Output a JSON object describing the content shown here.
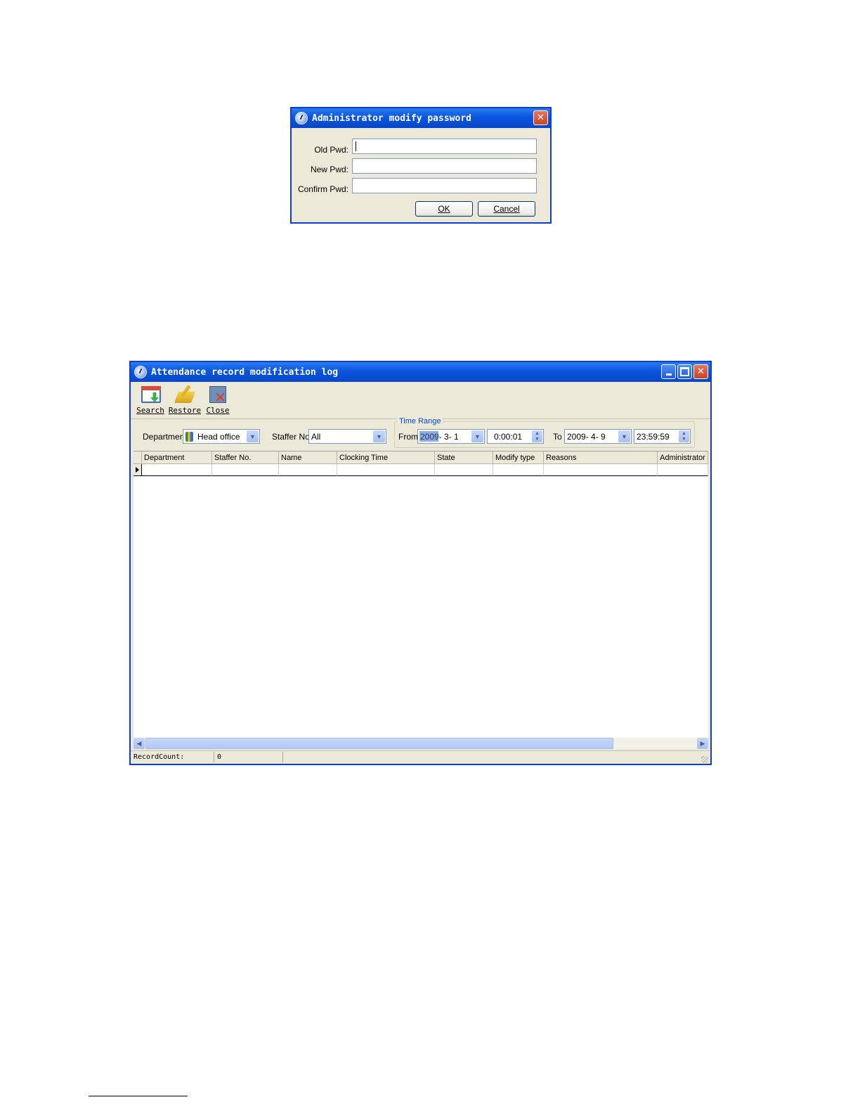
{
  "password_dialog": {
    "title": "Administrator modify password",
    "fields": [
      {
        "label": "Old Pwd:",
        "value": ""
      },
      {
        "label": "New Pwd:",
        "value": ""
      },
      {
        "label": "Confirm Pwd:",
        "value": ""
      }
    ],
    "ok_label": "OK",
    "cancel_label": "Cancel"
  },
  "log_window": {
    "title": "Attendance record modification log",
    "toolbar": [
      {
        "label": "Search",
        "icon": "search-icon"
      },
      {
        "label": "Restore",
        "icon": "restore-icon"
      },
      {
        "label": "Close",
        "icon": "close-icon"
      }
    ],
    "filters": {
      "department_label": "Department",
      "department_value": "Head office",
      "staffer_label": "Staffer No.",
      "staffer_value": "All",
      "time_range_label": "Time Range",
      "from_label": "From",
      "from_date": "2009- 3- 1",
      "from_time": "0:00:01",
      "to_label": "To",
      "to_date": "2009- 4- 9",
      "to_time": "23:59:59"
    },
    "columns": [
      "Department",
      "Staffer No.",
      "Name",
      "Clocking Time",
      "State",
      "Modify type",
      "Reasons",
      "Administrator"
    ],
    "status": {
      "label": "RecordCount:",
      "value": "0"
    }
  }
}
